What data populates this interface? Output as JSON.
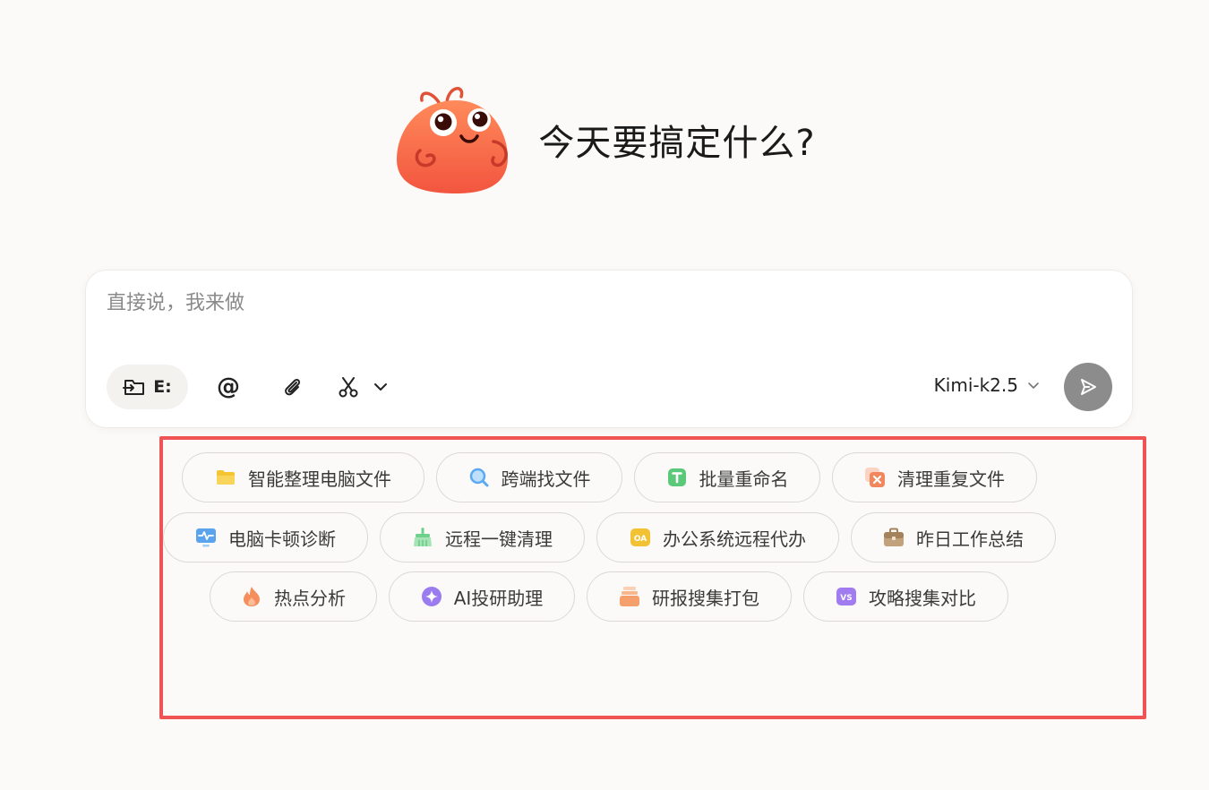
{
  "hero": {
    "title": "今天要搞定什么?",
    "mascot_icon": "orange-blob-mascot"
  },
  "composer": {
    "placeholder": "直接说，我来做",
    "value": "",
    "workdir_label": "E:",
    "workdir_icon": "folder-arrow-icon",
    "mention_icon": "at-icon",
    "attach_icon": "paperclip-icon",
    "clip_icon": "scissors-icon",
    "model_label": "Kimi-k2.5",
    "send_icon": "send-icon"
  },
  "suggestions": [
    {
      "label": "智能整理电脑文件",
      "icon": "folder-icon",
      "color": "#f5c431"
    },
    {
      "label": "跨端找文件",
      "icon": "magnifier-icon",
      "color": "#5aa9f2"
    },
    {
      "label": "批量重命名",
      "icon": "text-t-icon",
      "color": "#5bc87a"
    },
    {
      "label": "清理重复文件",
      "icon": "duplicate-remove-icon",
      "color": "#f2875e"
    },
    {
      "label": "电脑卡顿诊断",
      "icon": "monitor-pulse-icon",
      "color": "#5aa4ee"
    },
    {
      "label": "远程一键清理",
      "icon": "broom-icon",
      "color": "#6fcf8c"
    },
    {
      "label": "办公系统远程代办",
      "icon": "oa-icon",
      "color": "#f3c234"
    },
    {
      "label": "昨日工作总结",
      "icon": "briefcase-icon",
      "color": "#c2a27c"
    },
    {
      "label": "热点分析",
      "icon": "flame-icon",
      "color": "#f58d5c"
    },
    {
      "label": "AI投研助理",
      "icon": "sparkle-icon",
      "color": "#9b7bf0"
    },
    {
      "label": "研报搜集打包",
      "icon": "stack-box-icon",
      "color": "#f5a06c"
    },
    {
      "label": "攻略搜集对比",
      "icon": "vs-icon",
      "color": "#a07cf0"
    }
  ]
}
